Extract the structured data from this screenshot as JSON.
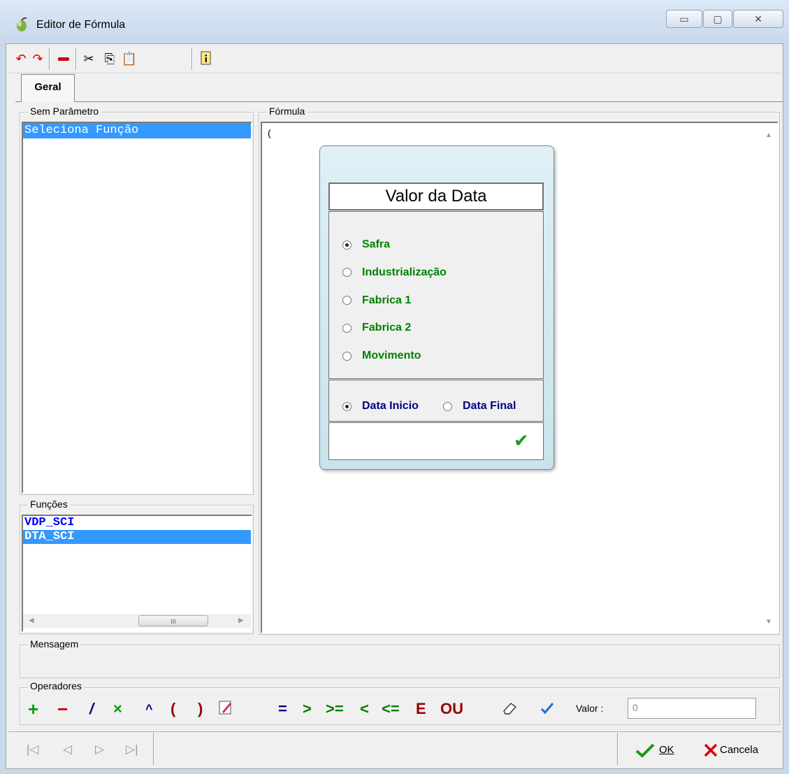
{
  "window": {
    "title": "Editor de Fórmula",
    "buttons": {
      "minimize": "▭",
      "maximize": "▢",
      "close": "✕"
    }
  },
  "toolbar": {
    "icons": [
      "undo-icon",
      "redo-icon",
      "remove-icon",
      "cut-icon",
      "copy-icon",
      "paste-icon",
      "info-icon"
    ]
  },
  "tabs": [
    {
      "label": "Geral"
    }
  ],
  "sem_parametro": {
    "legend": "Sem Parâmetro",
    "items": [
      "Seleciona Função"
    ]
  },
  "funcoes": {
    "legend": "Funções",
    "items": [
      "VDP_SCI",
      "DTA_SCI"
    ],
    "scroll_thumb": "III"
  },
  "formula": {
    "legend": "Fórmula",
    "text": "("
  },
  "dialog": {
    "title": "Valor da Data",
    "options": [
      "Safra",
      "Industrialização",
      "Fabrica 1",
      "Fabrica 2",
      "Movimento"
    ],
    "selected_option": "Safra",
    "date_options": [
      "Data Inicio",
      "Data Final"
    ],
    "selected_date": "Data Inicio",
    "confirm": "✔"
  },
  "mensagem": {
    "legend": "Mensagem"
  },
  "operadores": {
    "legend": "Operadores",
    "ops": [
      "+",
      "−",
      "/",
      "×",
      "^",
      "(",
      ")"
    ],
    "compare": [
      "=",
      ">",
      ">=",
      "<",
      "<=",
      "E",
      "OU"
    ],
    "valor_label": "Valor :",
    "valor_value": "0"
  },
  "footer": {
    "nav": [
      "|◁",
      "◁",
      "▷",
      "▷|"
    ],
    "ok_label": "OK",
    "cancel_label": "Cancela"
  },
  "colors": {
    "green": "#008000",
    "navy": "#000080",
    "red": "#cc0000",
    "selection": "#3399ff"
  }
}
